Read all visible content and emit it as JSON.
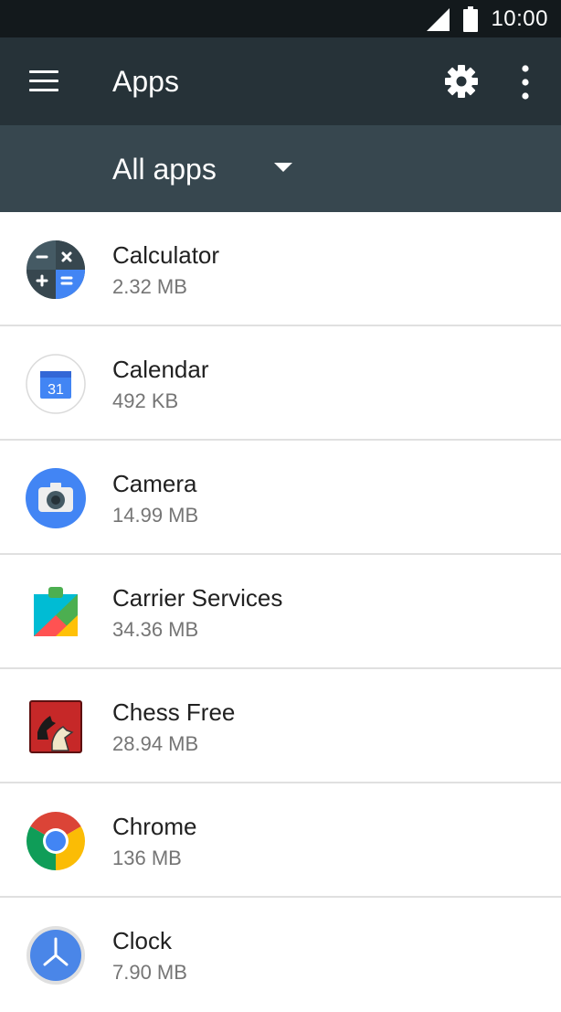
{
  "status_bar": {
    "time": "10:00",
    "signal_icon": "cell-signal-icon",
    "battery_icon": "battery-icon"
  },
  "app_bar": {
    "title": "Apps",
    "menu_icon": "menu-icon",
    "settings_icon": "gear-icon",
    "overflow_icon": "more-vert-icon"
  },
  "filter": {
    "label": "All apps",
    "dropdown_icon": "chevron-down-icon"
  },
  "apps": [
    {
      "name": "Calculator",
      "size": "2.32 MB",
      "icon": "calculator-icon"
    },
    {
      "name": "Calendar",
      "size": "492 KB",
      "icon": "calendar-icon",
      "icon_text": "31"
    },
    {
      "name": "Camera",
      "size": "14.99 MB",
      "icon": "camera-icon"
    },
    {
      "name": "Carrier Services",
      "size": "34.36 MB",
      "icon": "carrier-services-icon"
    },
    {
      "name": "Chess Free",
      "size": "28.94 MB",
      "icon": "chess-icon"
    },
    {
      "name": "Chrome",
      "size": "136 MB",
      "icon": "chrome-icon"
    },
    {
      "name": "Clock",
      "size": "7.90 MB",
      "icon": "clock-icon"
    }
  ],
  "colors": {
    "status_bar": "#13191c",
    "app_bar": "#263238",
    "filter_bar": "#37474f",
    "divider": "#e0e0e0",
    "primary_text": "#212121",
    "secondary_text": "#757575"
  }
}
